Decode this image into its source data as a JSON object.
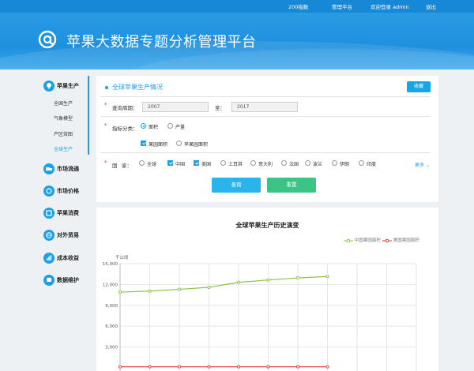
{
  "topbar": {
    "links": [
      "200指数",
      "管理平台",
      "欢迎登录 admin",
      "退出"
    ]
  },
  "header": {
    "title": "苹果大数据专题分析管理平台"
  },
  "sidebar": {
    "sections": [
      {
        "label": "苹果生产",
        "icon": "apple-tree-icon",
        "children": [
          "全国生产",
          "气象模型",
          "产区效图",
          "全球生产"
        ]
      },
      {
        "label": "市场流通",
        "icon": "truck-icon"
      },
      {
        "label": "市场价格",
        "icon": "price-icon"
      },
      {
        "label": "苹果消费",
        "icon": "consume-icon"
      },
      {
        "label": "对外贸易",
        "icon": "trade-icon"
      },
      {
        "label": "成本收益",
        "icon": "profit-icon"
      },
      {
        "label": "数据维护",
        "icon": "data-icon"
      }
    ],
    "active_child": "全球生产"
  },
  "form": {
    "title": "全球苹果生产情况",
    "save_label": "收藏",
    "period_label": "查询周期：",
    "period_from": "2007",
    "period_sep": "至：",
    "period_to": "2017",
    "metric_label": "指标分类：",
    "metric_options": [
      {
        "label": "面积",
        "selected": true
      },
      {
        "label": "产量",
        "selected": false
      }
    ],
    "sub_options": [
      {
        "label": "果园面积",
        "checked": true
      },
      {
        "label": "苹果园面积",
        "checked": false
      }
    ],
    "country_label": "国",
    "country_label2": "家：",
    "countries": [
      {
        "label": "全球",
        "type": "radio",
        "on": false
      },
      {
        "label": "中国",
        "type": "check",
        "on": true
      },
      {
        "label": "美国",
        "type": "check",
        "on": true
      },
      {
        "label": "土耳其",
        "type": "radio",
        "on": false
      },
      {
        "label": "意大利",
        "type": "radio",
        "on": false
      },
      {
        "label": "法国",
        "type": "radio",
        "on": false
      },
      {
        "label": "波兰",
        "type": "radio",
        "on": false
      },
      {
        "label": "伊朗",
        "type": "radio",
        "on": false
      },
      {
        "label": "印度",
        "type": "radio",
        "on": false
      }
    ],
    "more_label": "更多",
    "query_label": "查询",
    "reset_label": "重置",
    "colors": {
      "accent": "#1ea0e6",
      "query": "#29b4ec",
      "reset": "#3cc486"
    }
  },
  "chart_data": {
    "type": "line",
    "title": "全球苹果生产历史演变",
    "ylabel": "千公顷",
    "ylim": [
      0,
      15000
    ],
    "yticks": [
      "15,000",
      "12,000",
      "9,000",
      "6,000",
      "3,000"
    ],
    "legend_position": "top-right",
    "series": [
      {
        "name": "中国果园面积",
        "color": "#8bc34a",
        "values": [
          10900,
          11050,
          11300,
          11600,
          12300,
          12650,
          12950,
          13150
        ]
      },
      {
        "name": "美国果园面积",
        "color": "#e53935",
        "values": [
          150,
          150,
          150,
          150,
          150,
          150,
          150,
          150
        ]
      }
    ]
  }
}
